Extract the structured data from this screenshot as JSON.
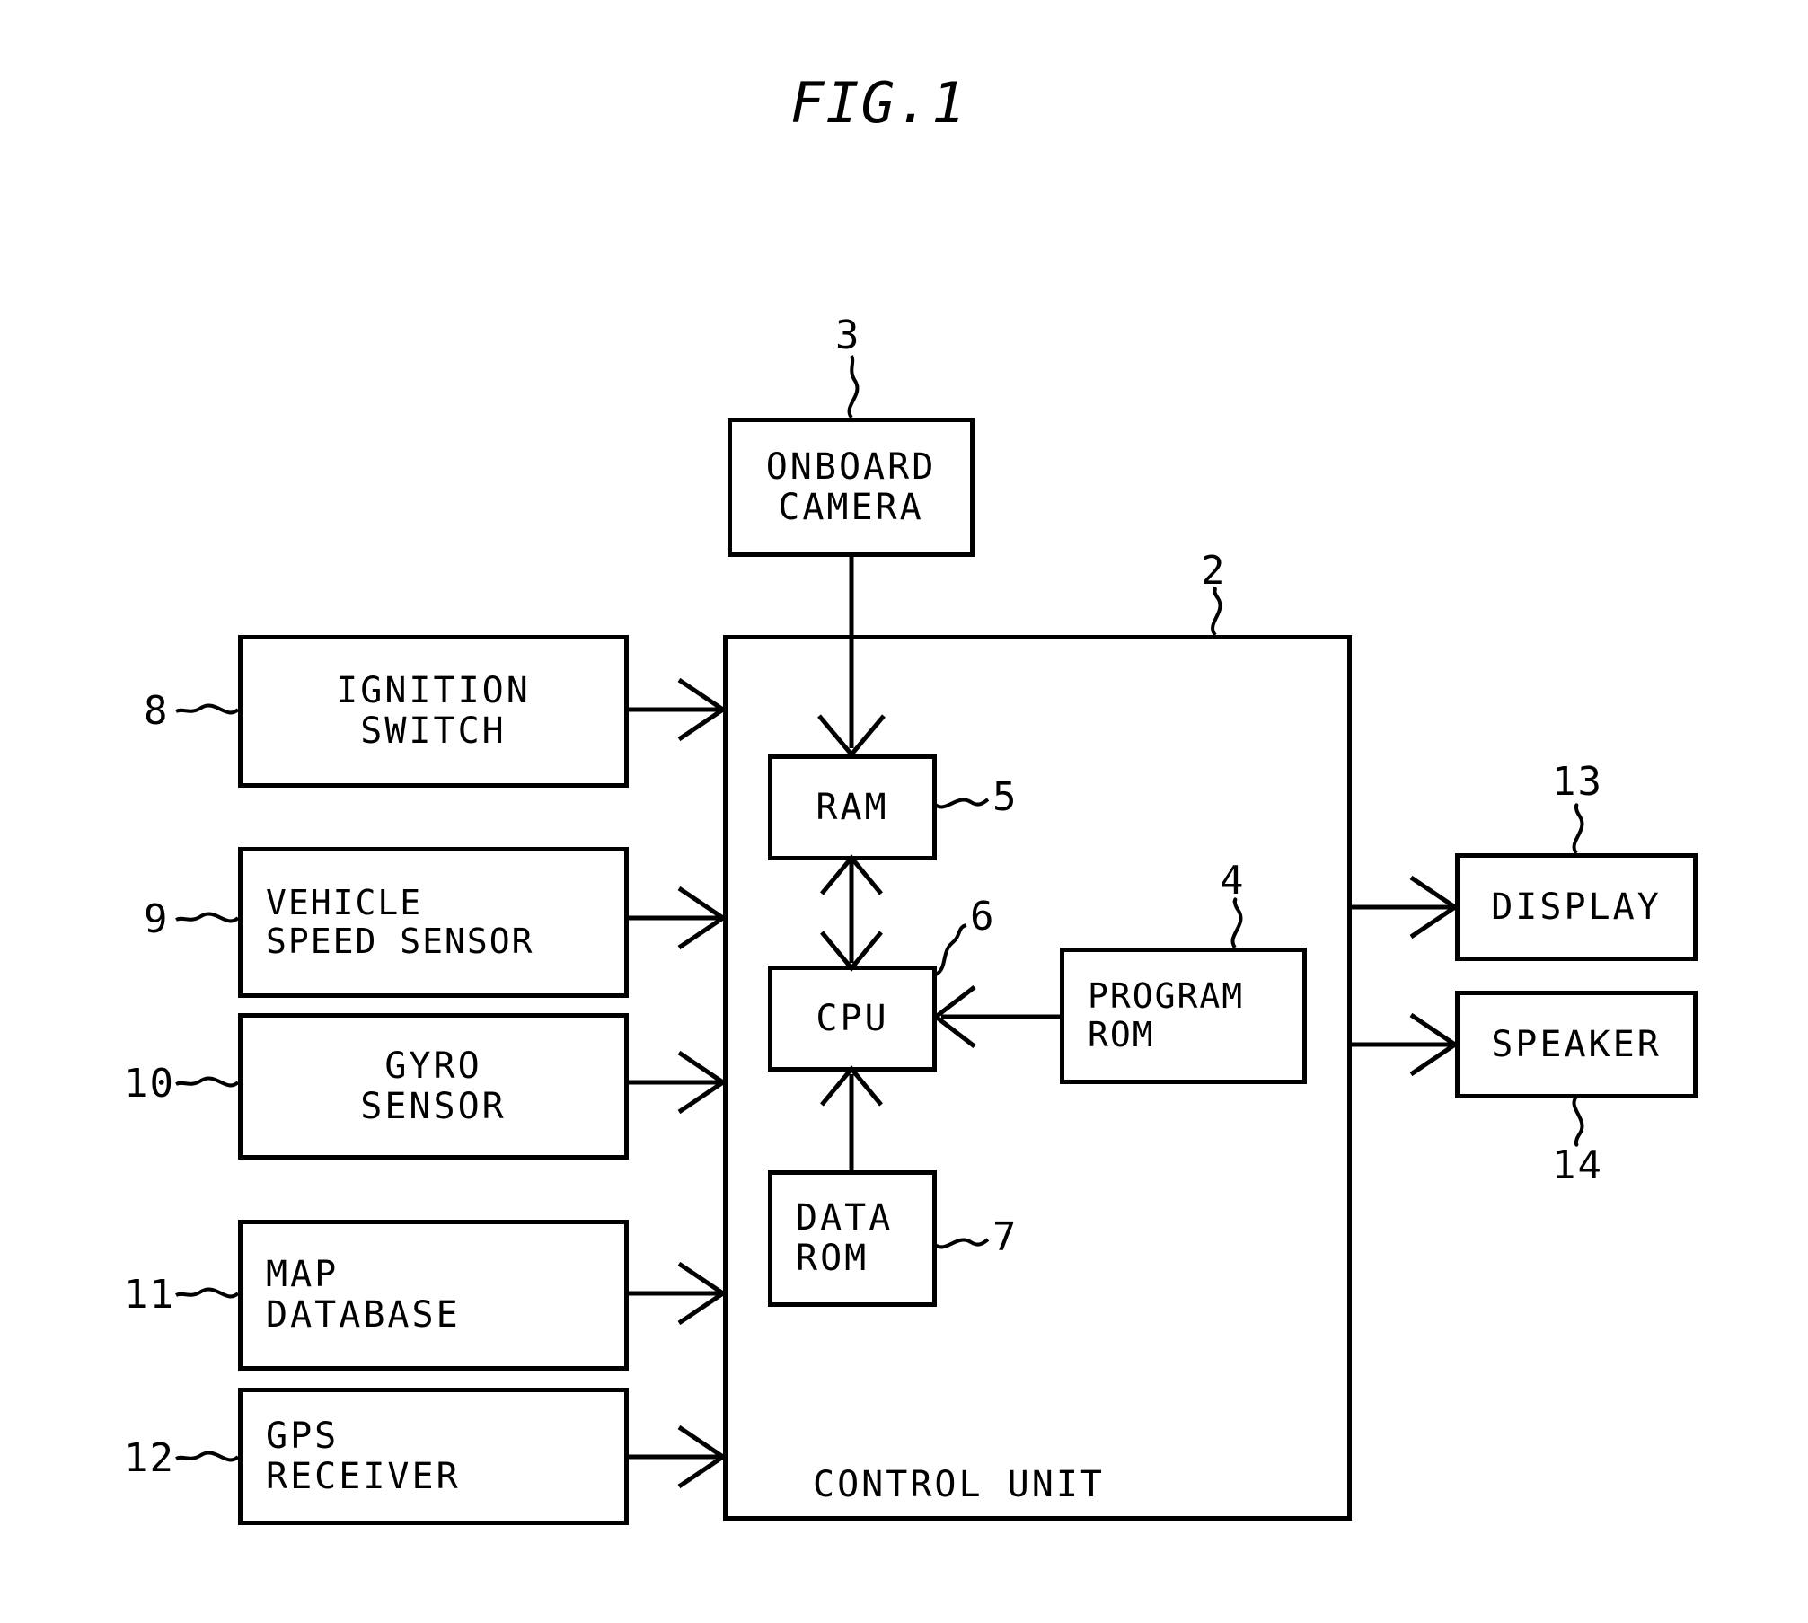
{
  "figure": {
    "title": "FIG.1",
    "type": "patent-block-diagram"
  },
  "blocks": {
    "onboard_camera": {
      "label": "ONBOARD\nCAMERA",
      "ref": "3"
    },
    "ignition_switch": {
      "label": "IGNITION\nSWITCH",
      "ref": "8"
    },
    "vehicle_speed_sensor": {
      "label": "VEHICLE\nSPEED SENSOR",
      "ref": "9"
    },
    "gyro_sensor": {
      "label": "GYRO\nSENSOR",
      "ref": "10"
    },
    "map_database": {
      "label": "MAP\nDATABASE",
      "ref": "11"
    },
    "gps_receiver": {
      "label": "GPS\nRECEIVER",
      "ref": "12"
    },
    "control_unit": {
      "label": "CONTROL UNIT",
      "ref": "2"
    },
    "ram": {
      "label": "RAM",
      "ref": "5"
    },
    "cpu": {
      "label": "CPU",
      "ref": "6"
    },
    "data_rom": {
      "label": "DATA\nROM",
      "ref": "7"
    },
    "program_rom": {
      "label": "PROGRAM\nROM",
      "ref": "4"
    },
    "display": {
      "label": "DISPLAY",
      "ref": "13"
    },
    "speaker": {
      "label": "SPEAKER",
      "ref": "14"
    }
  },
  "connections": [
    {
      "from": "onboard_camera",
      "to": "ram",
      "style": "arrow-down"
    },
    {
      "from": "ignition_switch",
      "to": "control_unit",
      "style": "arrow-right"
    },
    {
      "from": "vehicle_speed_sensor",
      "to": "control_unit",
      "style": "arrow-right"
    },
    {
      "from": "gyro_sensor",
      "to": "control_unit",
      "style": "arrow-right"
    },
    {
      "from": "map_database",
      "to": "control_unit",
      "style": "arrow-right"
    },
    {
      "from": "gps_receiver",
      "to": "control_unit",
      "style": "arrow-right"
    },
    {
      "from": "ram",
      "to": "cpu",
      "style": "bidirectional-vertical"
    },
    {
      "from": "data_rom",
      "to": "cpu",
      "style": "arrow-up"
    },
    {
      "from": "program_rom",
      "to": "cpu",
      "style": "arrow-left"
    },
    {
      "from": "control_unit",
      "to": "display",
      "style": "arrow-right"
    },
    {
      "from": "control_unit",
      "to": "speaker",
      "style": "arrow-right"
    }
  ]
}
